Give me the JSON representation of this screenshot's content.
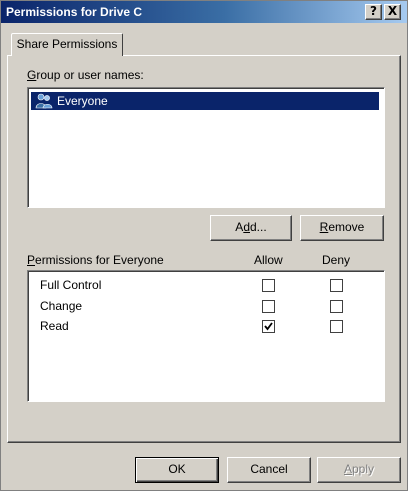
{
  "window": {
    "title": "Permissions for Drive C",
    "help_button": "?",
    "close_button": "X"
  },
  "tabs": [
    {
      "label": "Share Permissions",
      "selected": true
    }
  ],
  "group_section": {
    "label": "Group or user names:",
    "label_mnemonic": "G",
    "label_rest": "roup or user names:",
    "items": [
      {
        "label": "Everyone",
        "icon": "group-icon",
        "selected": true
      }
    ]
  },
  "buttons": {
    "add_mnemonic": "d",
    "add_pre": "A",
    "add_post": "d...",
    "remove_mnemonic": "R",
    "remove_rest": "emove",
    "ok": "OK",
    "cancel": "Cancel",
    "apply_mnemonic": "A",
    "apply_rest": "pply",
    "apply_enabled": false
  },
  "permissions": {
    "label_mnemonic": "P",
    "label_rest": "ermissions for Everyone",
    "allow_header": "Allow",
    "deny_header": "Deny",
    "rows": [
      {
        "name": "Full Control",
        "allow": false,
        "deny": false
      },
      {
        "name": "Change",
        "allow": false,
        "deny": false
      },
      {
        "name": "Read",
        "allow": true,
        "deny": false
      }
    ]
  },
  "colors": {
    "titlebar_start": "#0a246a",
    "titlebar_end": "#a6caf0",
    "dialog_face": "#d4d0c8",
    "selection": "#0a246a"
  }
}
